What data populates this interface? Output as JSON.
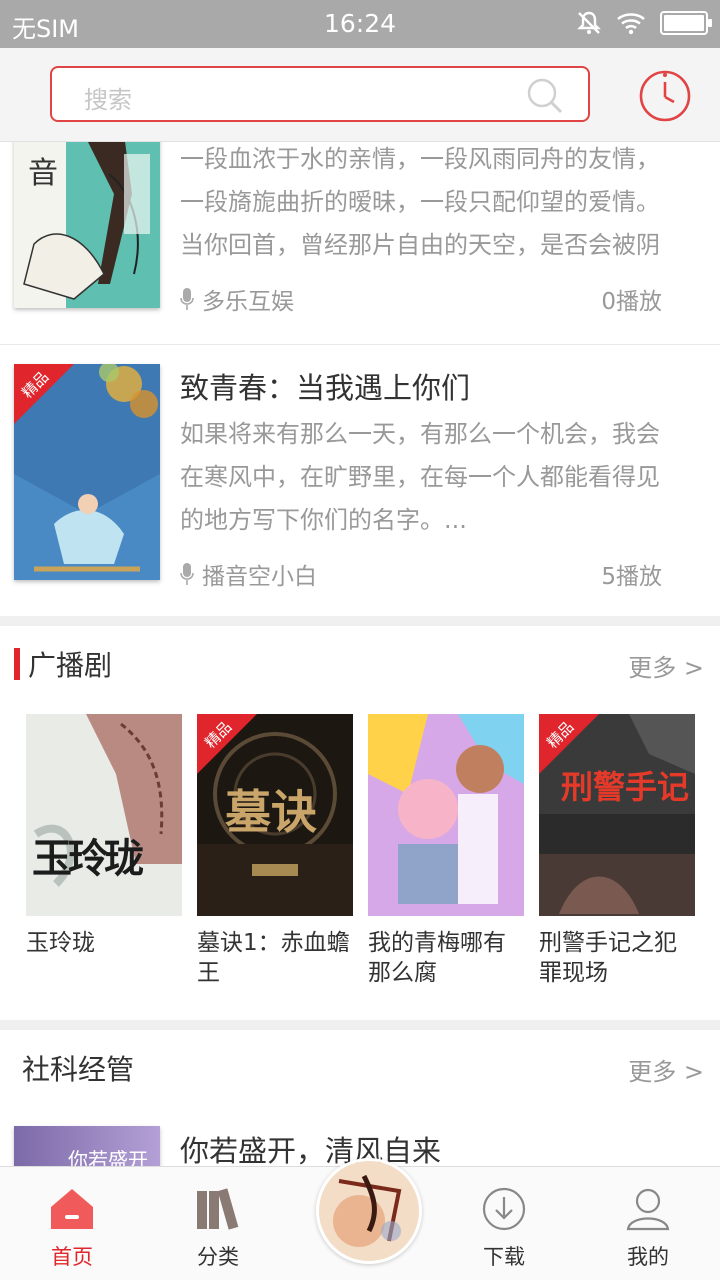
{
  "status_bar": {
    "carrier": "无SIM",
    "time": "16:24"
  },
  "header": {
    "search_placeholder": "搜索"
  },
  "top_items": [
    {
      "title": "",
      "cover_text": "音",
      "description": "一段血浓于水的亲情，一段风雨同舟的友情，一段旖旎曲折的暧昧，一段只配仰望的爱情。当你回首，曾经那片自由的天空，是否会被阴霾铺",
      "author": "多乐互娱",
      "plays": "0播放"
    },
    {
      "title": "致青春：当我遇上你们",
      "badge": "精品",
      "description": "如果将来有那么一天，有那么一个机会，我会在寒风中，在旷野里，在每一个人都能看得见的地方写下你们的名字。...",
      "author": "播音空小白",
      "plays": "5播放"
    }
  ],
  "radio_drama": {
    "heading": "广播剧",
    "more": "更多 >",
    "items": [
      {
        "name": "玉玲珑",
        "cover_text": "玉玲珑",
        "badge": ""
      },
      {
        "name": "墓诀1：赤血蟾王",
        "cover_text": "墓诀",
        "badge": "精品"
      },
      {
        "name": "我的青梅哪有那么腐",
        "cover_text": "",
        "badge": ""
      },
      {
        "name": "刑警手记之犯罪现场",
        "cover_text": "刑警手记",
        "badge": "精品"
      }
    ]
  },
  "social_science": {
    "heading": "社科经管",
    "more": "更多 >",
    "first_title": "你若盛开，清风自来",
    "first_cover_text": "你若盛开"
  },
  "nav": {
    "home": "首页",
    "category": "分类",
    "download": "下载",
    "mine": "我的"
  },
  "colors": {
    "accent": "#e0262c",
    "search_border": "#e04444"
  }
}
